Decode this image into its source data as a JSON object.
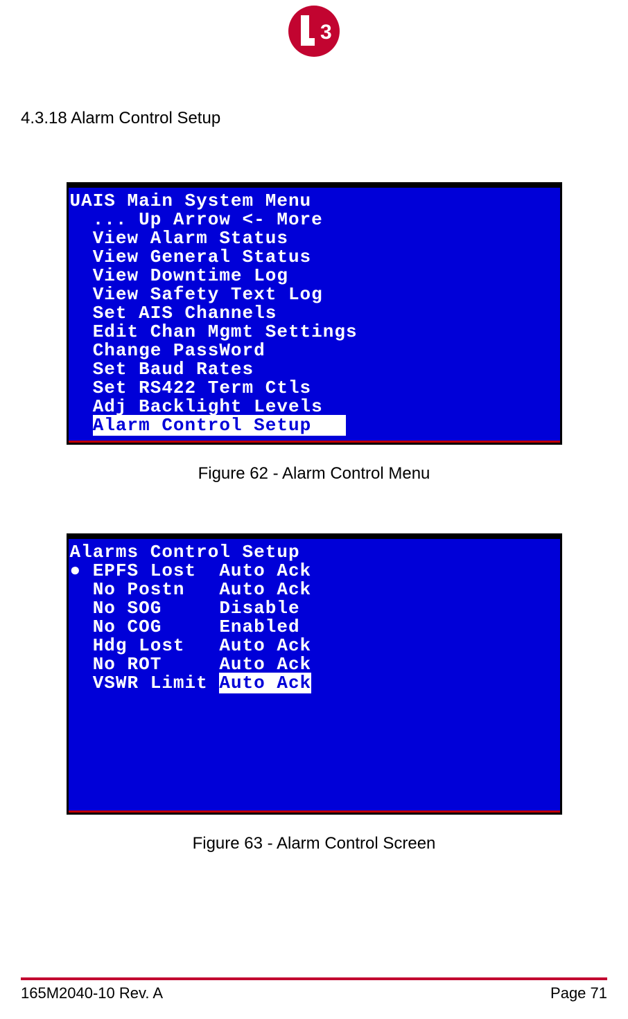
{
  "logo_text": "3",
  "section_heading": "4.3.18 Alarm Control Setup",
  "screen1": {
    "title": "UAIS Main System Menu",
    "nav_line": "  ... Up Arrow <- More",
    "items": [
      "  View Alarm Status",
      "  View General Status",
      "  View Downtime Log",
      "  View Safety Text Log",
      "  Set AIS Channels",
      "  Edit Chan Mgmt Settings",
      "  Change PassWord",
      "  Set Baud Rates",
      "  Set RS422 Term Ctls",
      "  Adj Backlight Levels"
    ],
    "selected": "Alarm Control Setup   ",
    "caption": "Figure 62 - Alarm Control Menu"
  },
  "screen2": {
    "title": "Alarms Control Setup",
    "rows": [
      {
        "bullet": true,
        "label": "EPFS Lost  ",
        "value": "Auto Ack",
        "selected": false
      },
      {
        "bullet": false,
        "label": "No Postn   ",
        "value": "Auto Ack",
        "selected": false
      },
      {
        "bullet": false,
        "label": "No SOG     ",
        "value": "Disable",
        "selected": false
      },
      {
        "bullet": false,
        "label": "No COG     ",
        "value": "Enabled",
        "selected": false
      },
      {
        "bullet": false,
        "label": "Hdg Lost   ",
        "value": "Auto Ack",
        "selected": false
      },
      {
        "bullet": false,
        "label": "No ROT     ",
        "value": "Auto Ack",
        "selected": false
      },
      {
        "bullet": false,
        "label": "VSWR Limit ",
        "value": "Auto Ack",
        "selected": true
      }
    ],
    "caption": "Figure 63 - Alarm Control Screen"
  },
  "footer": {
    "left": "165M2040-10 Rev. A",
    "right": "Page 71"
  }
}
